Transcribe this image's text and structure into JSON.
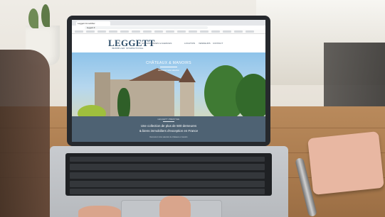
{
  "browser": {
    "tab_label": "Leggett Immobilier",
    "url": "leggett.fr"
  },
  "site": {
    "logo": "LEGGETT",
    "logo_sub": "IMMOBILIER INTERNATIONAL",
    "nav": [
      "NOS ANNONCES & AGENCES",
      "LOCATION",
      "VENDEURS",
      "CONTACT"
    ],
    "hero_title": "CHÂTEAUX & MANOIRS",
    "hero_sub": "Découvrez notre sélection",
    "band_kicker": "LEGGETT PRESTIGE",
    "band_line1": "Une collection de plus de 500 demeures",
    "band_line2": "& biens immobiliers d'exception en France",
    "band_note": "Découvrez notre sélection de châteaux et manoirs"
  },
  "colors": {
    "brand": "#2f4f6a",
    "band": "#4e6273"
  }
}
